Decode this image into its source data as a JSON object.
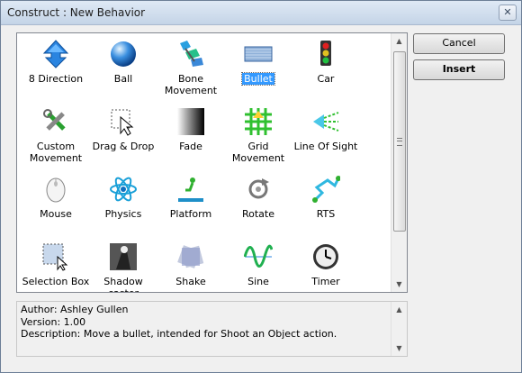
{
  "window": {
    "title": "Construct : New Behavior",
    "close_symbol": "✕"
  },
  "behaviors": [
    {
      "label": "8 Direction",
      "icon": "arrow-up-icon"
    },
    {
      "label": "Ball",
      "icon": "globe-icon"
    },
    {
      "label": "Bone\nMovement",
      "icon": "bone-icon"
    },
    {
      "label": "Bullet",
      "icon": "bullet-icon",
      "selected": true
    },
    {
      "label": "Car",
      "icon": "traffic-light-icon"
    },
    {
      "label": "Custom\nMovement",
      "icon": "tools-icon"
    },
    {
      "label": "Drag & Drop",
      "icon": "drag-cursor-icon"
    },
    {
      "label": "Fade",
      "icon": "fade-gradient-icon"
    },
    {
      "label": "Grid\nMovement",
      "icon": "grid-icon"
    },
    {
      "label": "Line Of Sight",
      "icon": "line-of-sight-icon"
    },
    {
      "label": "Mouse",
      "icon": "mouse-icon"
    },
    {
      "label": "Physics",
      "icon": "atom-icon"
    },
    {
      "label": "Platform",
      "icon": "platform-runner-icon"
    },
    {
      "label": "Rotate",
      "icon": "rotate-icon"
    },
    {
      "label": "RTS",
      "icon": "rts-path-icon"
    },
    {
      "label": "Selection Box",
      "icon": "selection-box-icon"
    },
    {
      "label": "Shadow\ncaster",
      "icon": "shadow-caster-icon"
    },
    {
      "label": "Shake",
      "icon": "shake-icon"
    },
    {
      "label": "Sine",
      "icon": "sine-wave-icon"
    },
    {
      "label": "Timer",
      "icon": "clock-icon"
    }
  ],
  "buttons": {
    "cancel": "Cancel",
    "insert": "Insert"
  },
  "description": {
    "author": "Author: Ashley Gullen",
    "version": "Version: 1.00",
    "text": "Description: Move a bullet, intended for Shoot an Object action."
  },
  "scroll": {
    "up_symbol": "▲",
    "down_symbol": "▼"
  },
  "colors": {
    "selection": "#3399ff",
    "window_bg": "#f0f0f0"
  }
}
